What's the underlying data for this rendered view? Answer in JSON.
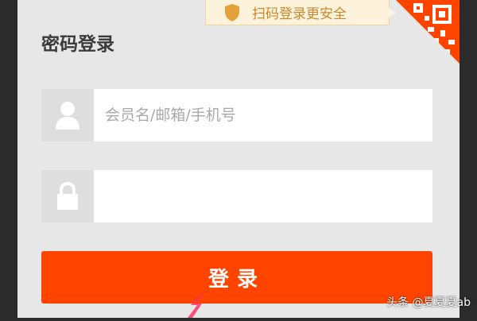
{
  "qr_tip": {
    "text": "扫码登录更安全",
    "icon": "shield-icon"
  },
  "qr_corner": {
    "icon": "qr-code-icon"
  },
  "form": {
    "title": "密码登录",
    "username": {
      "placeholder": "会员名/邮箱/手机号",
      "value": "",
      "icon": "user-icon"
    },
    "password": {
      "placeholder": "",
      "value": "",
      "icon": "lock-icon"
    },
    "submit_label": "登录"
  },
  "watermark": "头条 @夏夏夏ab",
  "colors": {
    "accent": "#ff4400",
    "tip_text": "#c9892b",
    "tip_bg": "#fdf3dd",
    "panel_bg": "#e7e7e7"
  }
}
